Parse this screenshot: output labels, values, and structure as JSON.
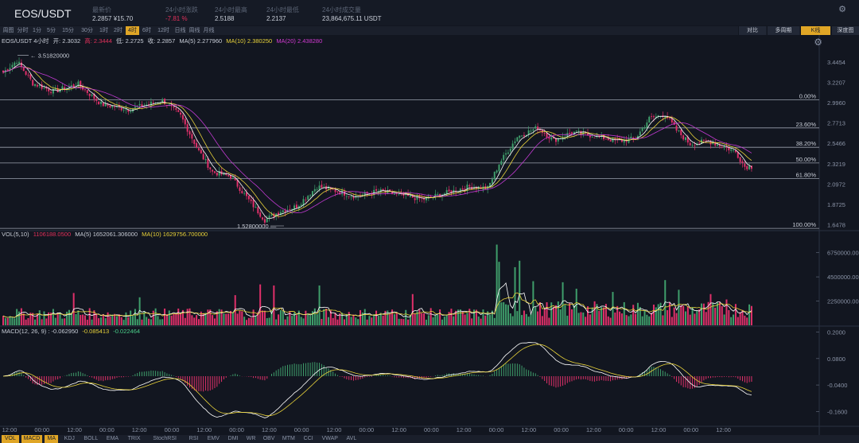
{
  "header": {
    "pair": "EOS/USDT",
    "stats": [
      {
        "label": "最新价",
        "value": "2.2857 ¥15.70",
        "neg": false
      },
      {
        "label": "24小时涨跌",
        "value": "-7.81 %",
        "neg": true
      },
      {
        "label": "24小时最高",
        "value": "2.5188",
        "neg": false
      },
      {
        "label": "24小时最低",
        "value": "2.2137",
        "neg": false
      },
      {
        "label": "24小时成交量",
        "value": "23,864,675.11 USDT",
        "neg": false
      }
    ]
  },
  "toolbar": {
    "timeframes": [
      "周图",
      "分时",
      "1分",
      "5分",
      "15分",
      "30分",
      "1时",
      "2时",
      "4时",
      "6时",
      "12时",
      "日线",
      "周线",
      "月线"
    ],
    "active_timeframe": "4时",
    "views": [
      "对比",
      "多周期",
      "K线",
      "深度图"
    ],
    "active_view": "K线"
  },
  "ohlc_info": {
    "symbol": "EOS/USDT 4小时",
    "open": "开: 2.3032",
    "high": "高: 2.3444",
    "low": "低: 2.2725",
    "close": "收: 2.2857",
    "ma5": "MA(5) 2.277960",
    "ma10": "MA(10) 2.380250",
    "ma20": "MA(20) 2.438280"
  },
  "vol_info": {
    "label": "VOL(5,10)",
    "vol": "1106188.0500",
    "ma5": "MA(5)  1652061.306000",
    "ma10": "MA(10)  1629756.700000"
  },
  "macd_info": {
    "label": "MACD(12, 26, 9) : -0.062950",
    "dea": "-0.085413",
    "hist": "-0.022464"
  },
  "indicators": [
    "VOL",
    "MACD",
    "MA",
    "KDJ",
    "BOLL",
    "EMA",
    "TRIX",
    "StochRSI",
    "RSI",
    "EMV",
    "DMI",
    "WR",
    "OBV",
    "MTM",
    "CCI",
    "VWAP",
    "AVL"
  ],
  "active_indicators": [
    "VOL",
    "MACD",
    "MA"
  ],
  "colors": {
    "up": "#3f9e6b",
    "down": "#e0306a",
    "ma5": "#ffffff",
    "ma10": "#e8d23a",
    "ma20": "#c23ad2",
    "accent": "#e0a626"
  },
  "chart_data": {
    "type": "candlestick",
    "x_labels": [
      "12:00",
      "00:00",
      "12:00",
      "00:00",
      "12:00",
      "00:00",
      "12:00",
      "00:00",
      "12:00",
      "00:00",
      "12:00",
      "00:00",
      "12:00",
      "00:00",
      "12:00",
      "00:00",
      "12:00",
      "00:00",
      "12:00",
      "00:00",
      "12:00",
      "00:00",
      "12:00"
    ],
    "price_axis": {
      "ticks": [
        "3.4454",
        "3.2207",
        "2.9960",
        "2.7713",
        "2.5466",
        "2.3219",
        "2.0972",
        "1.8725",
        "1.6478"
      ],
      "tick_values": [
        3.4454,
        3.2207,
        2.996,
        2.7713,
        2.5466,
        2.3219,
        2.0972,
        1.8725,
        1.6478
      ],
      "ylim": [
        1.6,
        3.62
      ]
    },
    "high_marker": "3.51820000",
    "low_marker": "1.52800000",
    "fibonacci": [
      {
        "label": "0.00%",
        "value": 3.028
      },
      {
        "label": "23.60%",
        "value": 2.717
      },
      {
        "label": "38.20%",
        "value": 2.503
      },
      {
        "label": "50.00%",
        "value": 2.33
      },
      {
        "label": "61.80%",
        "value": 2.158
      },
      {
        "label": "100.00%",
        "value": 1.608
      }
    ],
    "price_anchors": [
      [
        0,
        3.33
      ],
      [
        6,
        3.46
      ],
      [
        13,
        3.21
      ],
      [
        22,
        3.12
      ],
      [
        33,
        3.2
      ],
      [
        43,
        2.98
      ],
      [
        55,
        2.92
      ],
      [
        70,
        3.02
      ],
      [
        78,
        2.85
      ],
      [
        86,
        2.46
      ],
      [
        92,
        2.23
      ],
      [
        100,
        2.18
      ],
      [
        108,
        1.92
      ],
      [
        115,
        1.7
      ],
      [
        122,
        1.8
      ],
      [
        129,
        1.85
      ],
      [
        138,
        2.07
      ],
      [
        145,
        2.03
      ],
      [
        155,
        1.96
      ],
      [
        165,
        2.02
      ],
      [
        175,
        1.97
      ],
      [
        185,
        1.93
      ],
      [
        195,
        2.0
      ],
      [
        205,
        2.07
      ],
      [
        213,
        2.05
      ],
      [
        218,
        2.32
      ],
      [
        226,
        2.62
      ],
      [
        235,
        2.72
      ],
      [
        242,
        2.58
      ],
      [
        250,
        2.67
      ],
      [
        260,
        2.63
      ],
      [
        270,
        2.57
      ],
      [
        278,
        2.6
      ],
      [
        284,
        2.82
      ],
      [
        291,
        2.87
      ],
      [
        296,
        2.69
      ],
      [
        302,
        2.54
      ],
      [
        310,
        2.57
      ],
      [
        317,
        2.51
      ],
      [
        322,
        2.45
      ],
      [
        326,
        2.29
      ]
    ],
    "vol_axis": {
      "ticks": [
        "6750000.00",
        "4500000.00",
        "2250000.00"
      ],
      "tick_values": [
        6750000,
        4500000,
        2250000
      ],
      "ylim": [
        0,
        8500000
      ]
    },
    "volume_spikes": [
      [
        31,
        3.0
      ],
      [
        60,
        2.6
      ],
      [
        102,
        2.8
      ],
      [
        113,
        3.8
      ],
      [
        119,
        3.7
      ],
      [
        139,
        3.7
      ],
      [
        180,
        2.9
      ],
      [
        217,
        7.5
      ],
      [
        218,
        5.9
      ],
      [
        225,
        5.4
      ],
      [
        227,
        6.0
      ],
      [
        233,
        4.1
      ],
      [
        246,
        4.0
      ],
      [
        252,
        3.4
      ],
      [
        268,
        3.1
      ],
      [
        291,
        4.2
      ],
      [
        297,
        3.3
      ],
      [
        311,
        2.9
      ],
      [
        318,
        2.4
      ]
    ],
    "macd_axis": {
      "ticks": [
        "0.2000",
        "0.0800",
        "-0.0400",
        "-0.1600"
      ],
      "tick_values": [
        0.2,
        0.08,
        -0.04,
        -0.16
      ],
      "ylim": [
        -0.22,
        0.22
      ]
    },
    "macd_dif": [
      -0.07,
      -0.085413,
      -0.06295
    ],
    "macd_hist": -0.022464
  }
}
